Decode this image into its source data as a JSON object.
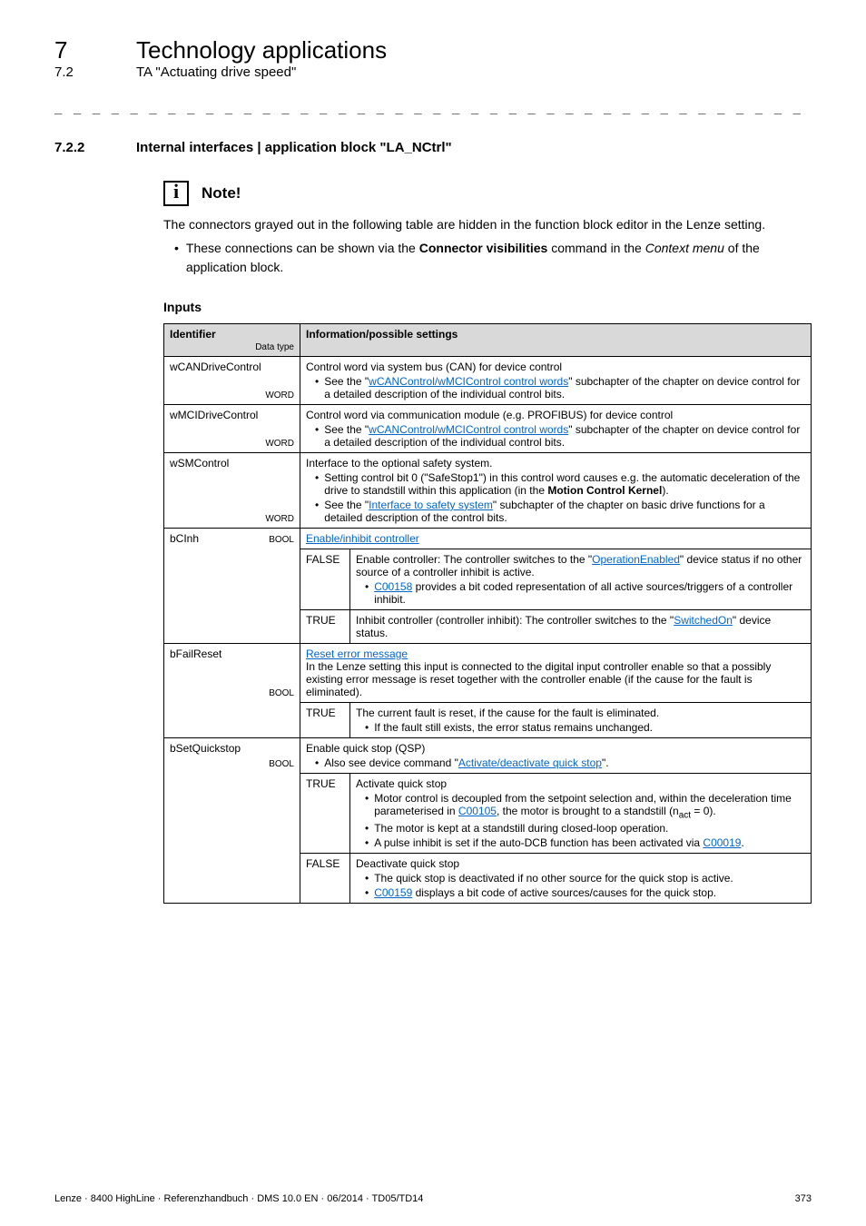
{
  "header": {
    "num": "7",
    "title": "Technology applications"
  },
  "subheader": {
    "num": "7.2",
    "title": "TA \"Actuating drive speed\""
  },
  "separator": "_ _ _ _ _ _ _ _ _ _ _ _ _ _ _ _ _ _ _ _ _ _ _ _ _ _ _ _ _ _ _ _ _ _ _ _ _ _ _ _ _ _ _ _ _ _ _ _ _ _ _ _ _ _ _ _ _ _ _ _ _ _ _ _",
  "section": {
    "num": "7.2.2",
    "title": "Internal interfaces | application block \"LA_NCtrl\""
  },
  "note": {
    "icon_glyph": "i",
    "label": "Note!",
    "body": "The connectors grayed out in the following table are hidden in the function block editor in the Lenze setting.",
    "bullet_pre": "• ",
    "bullet_text1": "These connections can be shown via the ",
    "bullet_bold": "Connector visibilities",
    "bullet_text2": " command in the ",
    "bullet_italic": "Context menu",
    "bullet_text3": " of the application block."
  },
  "inputs_label": "Inputs",
  "table": {
    "head_identifier": "Identifier",
    "head_datatype": "Data type",
    "head_info": "Information/possible settings",
    "rows": {
      "wCANDriveControl": {
        "id": "wCANDriveControl",
        "dtype": "WORD",
        "l1": "Control word via system bus (CAN) for device control",
        "b1a": "See the \"",
        "b1link": "wCANControl/wMCIControl control words",
        "b1b": "\" subchapter of the chapter on device control for a detailed description of the individual control bits."
      },
      "wMCIDriveControl": {
        "id": "wMCIDriveControl",
        "dtype": "WORD",
        "l1": "Control word via communication module (e.g. PROFIBUS) for device control",
        "b1a": "See the \"",
        "b1link": "wCANControl/wMCIControl control words",
        "b1b": "\" subchapter of the chapter on device control for a detailed description of the individual control bits."
      },
      "wSMControl": {
        "id": "wSMControl",
        "dtype": "WORD",
        "l1": "Interface to the optional safety system.",
        "b1a": "Setting control bit 0 (\"SafeStop1\") in this control word causes e.g. the automatic deceleration of the drive to standstill within this application (in the ",
        "b1bold": "Motion Control Kernel",
        "b1b": ").",
        "b2a": "See the \"",
        "b2link": "Interface to safety system",
        "b2b": "\" subchapter of the chapter on basic drive functions for a detailed description of the control bits."
      },
      "bCInh": {
        "id": "bCInh",
        "dtype": "BOOL",
        "toplink": "Enable/inhibit controller",
        "false_label": "FALSE",
        "false_l1a": "Enable controller: The controller switches to the \"",
        "false_l1link": "OperationEnabled",
        "false_l1b": "\" device status if no other source of a controller inhibit is active.",
        "false_b1a": "",
        "false_b1link": "C00158",
        "false_b1b": " provides a bit coded representation of all active sources/triggers of a controller inhibit.",
        "true_label": "TRUE",
        "true_l1a": "Inhibit controller (controller inhibit): The controller switches to the \"",
        "true_l1link": "SwitchedOn",
        "true_l1b": "\" device status."
      },
      "bFailReset": {
        "id": "bFailReset",
        "dtype": "BOOL",
        "toplink": "Reset error message",
        "topbody": "In the Lenze setting this input is connected to the digital input controller enable so that a possibly existing error message is reset together with the controller enable (if the cause for the fault is eliminated).",
        "true_label": "TRUE",
        "true_l1": "The current fault is reset, if the cause for the fault is eliminated.",
        "true_b1": "If the fault still exists, the error status remains unchanged."
      },
      "bSetQuickstop": {
        "id": "bSetQuickstop",
        "dtype": "BOOL",
        "top_l1": "Enable quick stop (QSP)",
        "top_b1a": "Also see device command \"",
        "top_b1link": "Activate/deactivate quick stop",
        "top_b1b": "\".",
        "true_label": "TRUE",
        "true_l1": "Activate quick stop",
        "true_b1": "Motor control is decoupled from the setpoint selection and, within the deceleration time parameterised in ",
        "true_b1link": "C00105",
        "true_b1b": ", the motor is brought to a standstill (n",
        "true_b1sub": "act",
        "true_b1c": " = 0).",
        "true_b2": "The motor is kept at a standstill during closed-loop operation.",
        "true_b3a": "A pulse inhibit is set if the auto-DCB function has been activated via ",
        "true_b3link": "C00019",
        "true_b3b": ".",
        "false_label": "FALSE",
        "false_l1": "Deactivate quick stop",
        "false_b1": "The quick stop is deactivated if no other source for the quick stop is active.",
        "false_b2a": "",
        "false_b2link": "C00159",
        "false_b2b": " displays a bit code of active sources/causes for the quick stop."
      }
    }
  },
  "footer": {
    "left": "Lenze · 8400 HighLine · Referenzhandbuch · DMS 10.0 EN · 06/2014 · TD05/TD14",
    "right": "373"
  }
}
